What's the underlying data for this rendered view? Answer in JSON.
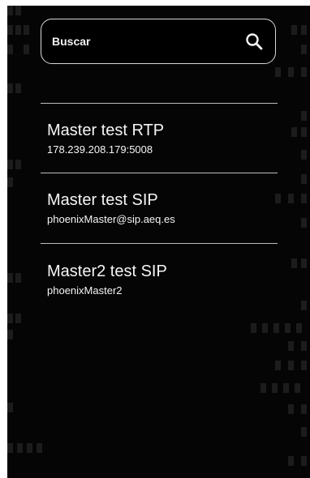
{
  "search": {
    "placeholder": "Buscar"
  },
  "contacts": [
    {
      "name": "Master test RTP",
      "address": "178.239.208.179:5008"
    },
    {
      "name": "Master test SIP",
      "address": "phoenixMaster@sip.aeq.es"
    },
    {
      "name": "Master2 test SIP",
      "address": "phoenixMaster2"
    }
  ],
  "colors": {
    "background": "#050505",
    "text": "#f5f5f5",
    "divider": "#bdbdbd",
    "pixel": "#1c1c1c"
  },
  "icons": {
    "search": "search-icon"
  }
}
